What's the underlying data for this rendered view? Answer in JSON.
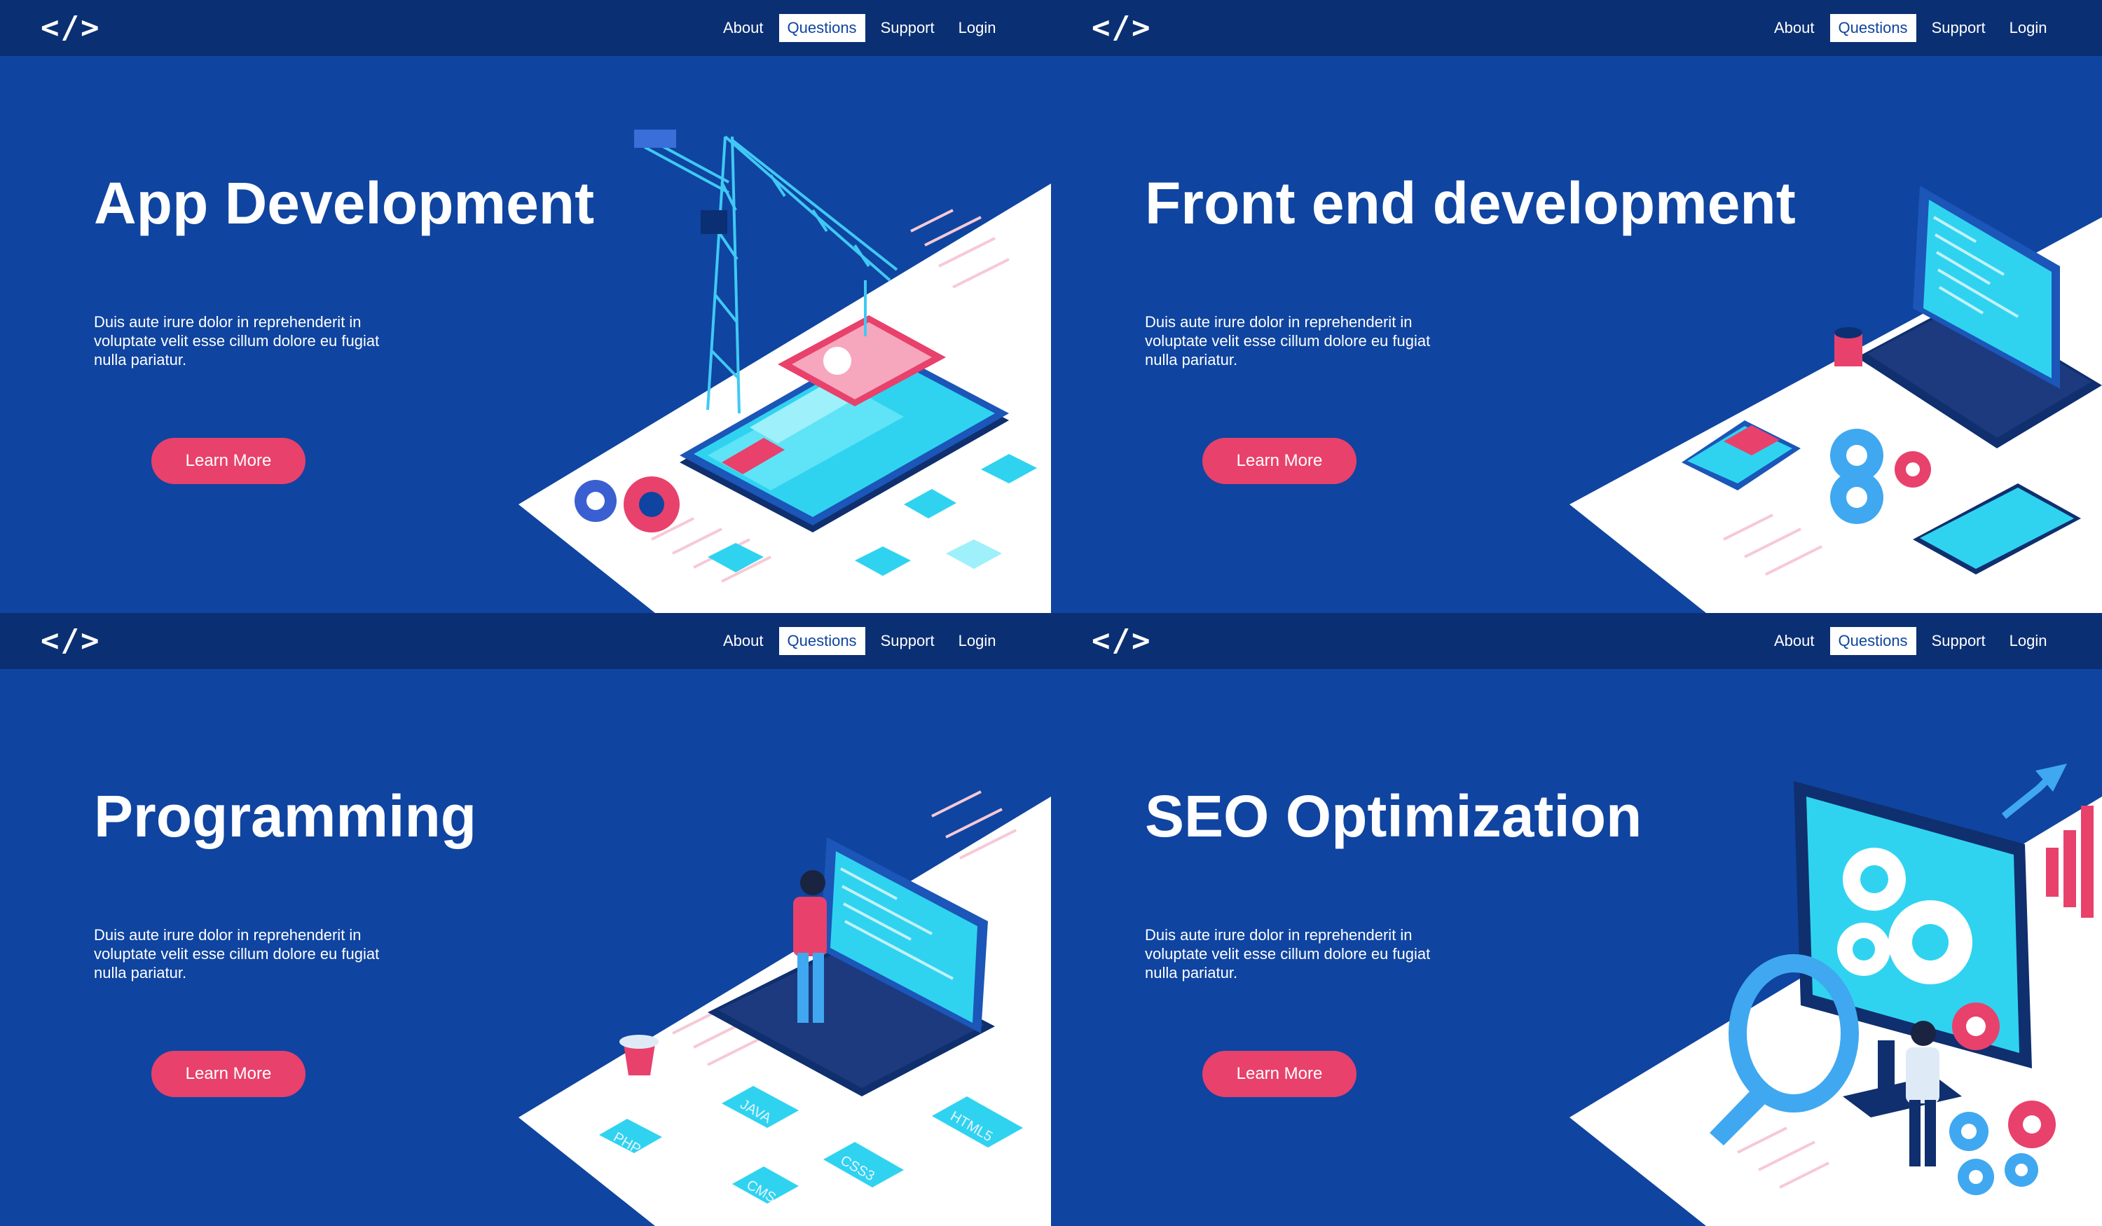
{
  "nav": {
    "logo": "</>",
    "items": [
      "About",
      "Questions",
      "Support",
      "Login"
    ],
    "active": "Questions"
  },
  "panels": [
    {
      "title": "App Development",
      "desc": "Duis aute irure dolor in reprehenderit in voluptate velit esse  cillum dolore eu fugiat nulla pariatur.",
      "button": "Learn More"
    },
    {
      "title": "Front end development",
      "desc": "Duis aute irure dolor in reprehenderit in voluptate velit esse  cillum dolore eu fugiat nulla pariatur.",
      "button": "Learn More"
    },
    {
      "title": "Programming",
      "desc": "Duis aute irure dolor in reprehenderit in voluptate velit esse  cillum dolore eu fugiat nulla pariatur.",
      "button": "Learn More",
      "tags": [
        "PHP",
        "JAVA",
        "HTML5",
        "CMS",
        "CSS3"
      ]
    },
    {
      "title": "SEO Optimization",
      "desc": "Duis aute irure dolor in reprehenderit in voluptate velit esse  cillum dolore eu fugiat nulla pariatur.",
      "button": "Learn More"
    }
  ],
  "colors": {
    "background": "#0f44a0",
    "nav": "#0b2f73",
    "accent": "#e8416c",
    "cyan": "#2fd3f0"
  },
  "icons": [
    "code-logo-icon",
    "crane-icon",
    "smartphone-icon",
    "gear-icon",
    "laptop-icon",
    "coffee-cup-icon",
    "tablet-icon",
    "monitor-icon",
    "magnifier-icon",
    "growth-chart-icon",
    "person-icon"
  ]
}
